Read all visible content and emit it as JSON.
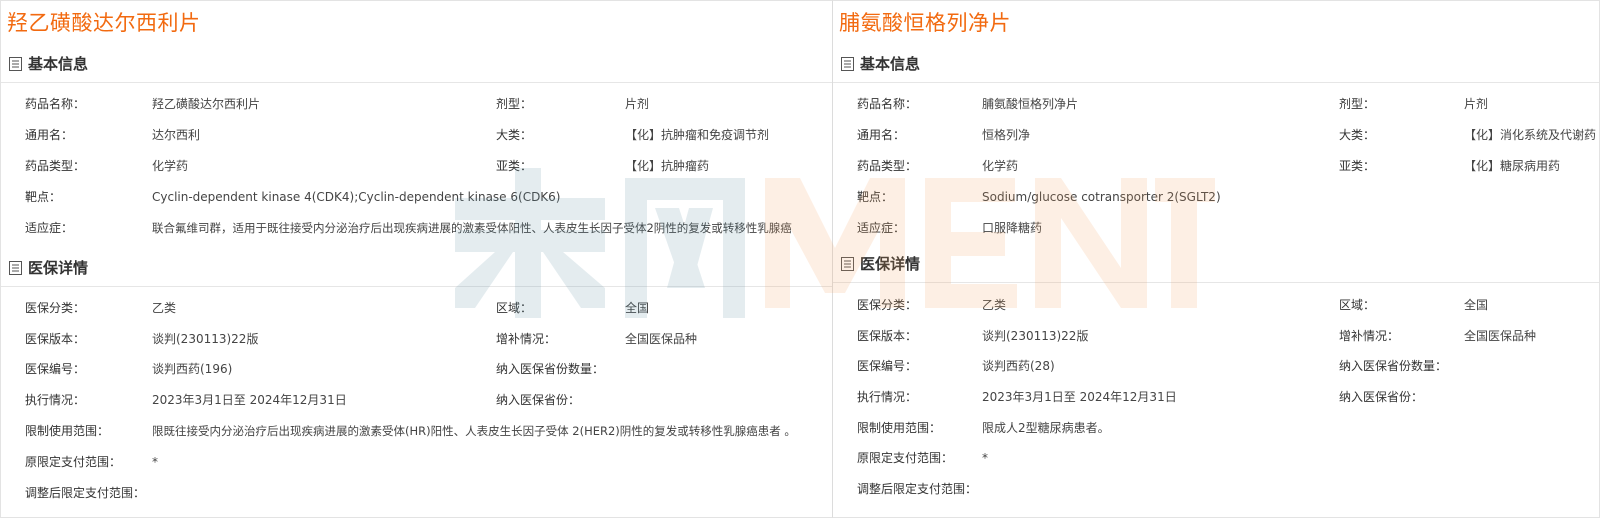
{
  "left": {
    "title": "羟乙磺酸达尔西利片",
    "basic": {
      "heading": "基本信息",
      "drug_name_label": "药品名称：",
      "drug_name": "羟乙磺酸达尔西利片",
      "form_label": "剂型：",
      "form": "片剂",
      "generic_label": "通用名：",
      "generic": "达尔西利",
      "category_label": "大类：",
      "category": "【化】抗肿瘤和免疫调节剂",
      "type_label": "药品类型：",
      "type": "化学药",
      "subcategory_label": "亚类：",
      "subcategory": "【化】抗肿瘤药",
      "target_label": "靶点：",
      "target": "Cyclin-dependent kinase 4(CDK4);Cyclin-dependent kinase 6(CDK6)",
      "indication_label": "适应症：",
      "indication": "联合氟维司群，适用于既往接受内分泌治疗后出现疾病进展的激素受体阳性、人表皮生长因子受体2阴性的复发或转移性乳腺癌"
    },
    "insurance": {
      "heading": "医保详情",
      "class_label": "医保分类：",
      "class": "乙类",
      "region_label": "区域：",
      "region": "全国",
      "version_label": "医保版本：",
      "version": "谈判(230113)22版",
      "supplement_label": "增补情况：",
      "supplement": "全国医保品种",
      "code_label": "医保编号：",
      "code": "谈判西药(196)",
      "province_count_label": "纳入医保省份数量：",
      "exec_label": "执行情况：",
      "exec": "2023年3月1日至 2024年12月31日",
      "provinces_label": "纳入医保省份：",
      "limit_label": "限制使用范围：",
      "limit": "限既往接受内分泌治疗后出现疾病进展的激素受体(HR)阳性、人表皮生长因子受体 2(HER2)阴性的复发或转移性乳腺癌患者 。",
      "orig_pay_label": "原限定支付范围：",
      "orig_pay": "*",
      "adj_pay_label": "调整后限定支付范围："
    }
  },
  "right": {
    "title": "脯氨酸恒格列净片",
    "basic": {
      "heading": "基本信息",
      "drug_name_label": "药品名称：",
      "drug_name": "脯氨酸恒格列净片",
      "form_label": "剂型：",
      "form": "片剂",
      "generic_label": "通用名：",
      "generic": "恒格列净",
      "category_label": "大类：",
      "category": "【化】消化系统及代谢药",
      "type_label": "药品类型：",
      "type": "化学药",
      "subcategory_label": "亚类：",
      "subcategory": "【化】糖尿病用药",
      "target_label": "靶点：",
      "target": "Sodium/glucose cotransporter 2(SGLT2)",
      "indication_label": "适应症：",
      "indication": "口服降糖药"
    },
    "insurance": {
      "heading": "医保详情",
      "class_label": "医保分类：",
      "class": "乙类",
      "region_label": "区域：",
      "region": "全国",
      "version_label": "医保版本：",
      "version": "谈判(230113)22版",
      "supplement_label": "增补情况：",
      "supplement": "全国医保品种",
      "code_label": "医保编号：",
      "code": "谈判西药(28)",
      "province_count_label": "纳入医保省份数量：",
      "exec_label": "执行情况：",
      "exec": "2023年3月1日至 2024年12月31日",
      "provinces_label": "纳入医保省份：",
      "limit_label": "限制使用范围：",
      "limit": "限成人2型糖尿病患者。",
      "orig_pay_label": "原限定支付范围：",
      "orig_pay": "*",
      "adj_pay_label": "调整后限定支付范围："
    }
  },
  "watermark": {
    "text": "米内MENET",
    "color_left": "#5b8fa3",
    "color_right": "#f5a25d"
  },
  "colors": {
    "title": "#f26a10",
    "text": "#333333",
    "rule": "#e6e6e6"
  }
}
